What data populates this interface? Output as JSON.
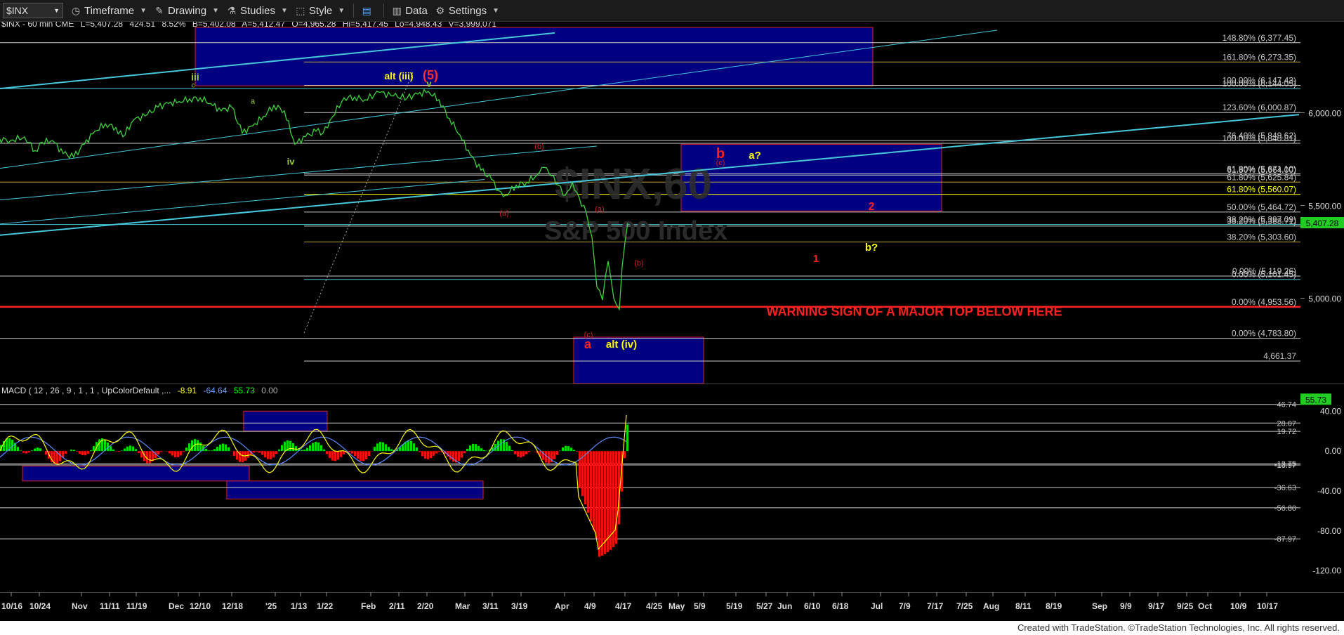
{
  "toolbar": {
    "symbol": "$INX",
    "timeframe_label": "Timeframe",
    "drawing_label": "Drawing",
    "studies_label": "Studies",
    "style_label": "Style",
    "data_label": "Data",
    "settings_label": "Settings"
  },
  "footer": {
    "credit": "Created with TradeStation. ©TradeStation Technologies, Inc. All rights reserved."
  },
  "chart_data": {
    "type": "line",
    "header": "$INX - 60 min  CME",
    "quote": {
      "last": "L=5,407.28",
      "change": "424.51",
      "pct": "8.52%",
      "bid": "B=5,402.08",
      "ask": "A=5,412.47",
      "open": "O=4,965.28",
      "high": "Hi=5,417.45",
      "low": "Lo=4,948.43",
      "volume": "V=3,999,071"
    },
    "watermark": {
      "symbol": "$INX,60",
      "name": "S&P 500 Index"
    },
    "ylim": [
      4540,
      6460
    ],
    "price_axis_ticks": [
      "6,000.00",
      "5,500.00",
      "5,000.00"
    ],
    "last_price_badge": "5,407.28",
    "x_tick_labels": [
      "10/16",
      "10/24",
      "Nov",
      "11/11",
      "11/19",
      "Dec",
      "12/10",
      "12/18",
      "'25",
      "1/13",
      "1/22",
      "Feb",
      "2/11",
      "2/20",
      "Mar",
      "3/11",
      "3/19",
      "Apr",
      "4/9",
      "4/17",
      "4/25",
      "May",
      "5/9",
      "5/19",
      "5/27",
      "Jun",
      "6/10",
      "6/18",
      "Jul",
      "7/9",
      "7/17",
      "7/25",
      "Aug",
      "8/11",
      "8/19",
      "Sep",
      "9/9",
      "9/17",
      "9/25",
      "Oct",
      "10/9",
      "10/17"
    ],
    "price_series": [
      [
        -5,
        5860
      ],
      [
        15,
        5850
      ],
      [
        35,
        5870
      ],
      [
        50,
        5795
      ],
      [
        60,
        5840
      ],
      [
        75,
        5850
      ],
      [
        90,
        5780
      ],
      [
        105,
        5760
      ],
      [
        120,
        5830
      ],
      [
        135,
        5900
      ],
      [
        150,
        5940
      ],
      [
        165,
        5920
      ],
      [
        175,
        5870
      ],
      [
        190,
        5960
      ],
      [
        210,
        5990
      ],
      [
        225,
        6030
      ],
      [
        240,
        6050
      ],
      [
        255,
        6060
      ],
      [
        270,
        6075
      ],
      [
        285,
        6080
      ],
      [
        300,
        6050
      ],
      [
        315,
        6010
      ],
      [
        330,
        6030
      ],
      [
        345,
        5890
      ],
      [
        360,
        5930
      ],
      [
        375,
        5980
      ],
      [
        390,
        6040
      ],
      [
        405,
        6010
      ],
      [
        420,
        5830
      ],
      [
        435,
        5870
      ],
      [
        450,
        5900
      ],
      [
        460,
        5890
      ],
      [
        470,
        5960
      ],
      [
        490,
        6080
      ],
      [
        505,
        6085
      ],
      [
        520,
        6070
      ],
      [
        540,
        6110
      ],
      [
        560,
        6090
      ],
      [
        580,
        6080
      ],
      [
        595,
        6100
      ],
      [
        610,
        6115
      ],
      [
        625,
        6070
      ],
      [
        640,
        5970
      ],
      [
        655,
        5880
      ],
      [
        670,
        5770
      ],
      [
        685,
        5690
      ],
      [
        700,
        5640
      ],
      [
        710,
        5580
      ],
      [
        720,
        5555
      ],
      [
        735,
        5610
      ],
      [
        750,
        5625
      ],
      [
        765,
        5665
      ],
      [
        775,
        5705
      ],
      [
        785,
        5660
      ],
      [
        795,
        5610
      ],
      [
        805,
        5555
      ],
      [
        815,
        5625
      ],
      [
        825,
        5540
      ],
      [
        835,
        5460
      ],
      [
        843,
        5330
      ],
      [
        850,
        5060
      ],
      [
        858,
        4990
      ],
      [
        866,
        5200
      ],
      [
        874,
        5000
      ],
      [
        882,
        4940
      ],
      [
        886,
        5170
      ],
      [
        890,
        5300
      ],
      [
        894,
        5407
      ]
    ],
    "fib_levels": [
      {
        "label": "148.80% (6,377.45)",
        "price": 6377.45,
        "color": "#c8c8c8"
      },
      {
        "label": "161.80% (6,273.35)",
        "price": 6273.35,
        "color": "#bfa23a"
      },
      {
        "label": "100.00% (6,147.43)",
        "price": 6147.43,
        "color": "#c8c8c8"
      },
      {
        "label": "100.00% (6,144.05)",
        "price": 6130,
        "color": "#46c8dc"
      },
      {
        "label": "123.60% (6,000.87)",
        "price": 6000.87,
        "color": "#c8c8c8"
      },
      {
        "label": "76.40% (5,849.62)",
        "price": 5849.62,
        "color": "#c8c8c8"
      },
      {
        "label": "100.00% (5,840.81)",
        "price": 5835,
        "color": "#c8c8c8"
      },
      {
        "label": "61.80% (5,671.10)",
        "price": 5671.1,
        "color": "#c8c8c8"
      },
      {
        "label": "61.80% (5,664.00)",
        "price": 5664,
        "color": "#c8c8c8"
      },
      {
        "label": "61.80% (5,625.84)",
        "price": 5625.84,
        "color": "#bfa23a"
      },
      {
        "label": "61.80% (5,560.07)",
        "price": 5560.07,
        "color": "#ffff00"
      },
      {
        "label": "50.00% (5,464.72)",
        "price": 5464.72,
        "color": "#c8c8c8"
      },
      {
        "label": "38.20% (5,397.09)",
        "price": 5397.09,
        "color": "#46c8dc"
      },
      {
        "label": "38.20% (5,388.71)",
        "price": 5388.71,
        "color": "#c8c8c8"
      },
      {
        "label": "38.20% (5,303.60)",
        "price": 5303.6,
        "color": "#bfa23a"
      },
      {
        "label": "0.00% (5,119.26)",
        "price": 5119.26,
        "color": "#c8c8c8"
      },
      {
        "label": "0.00% (5,101.45)",
        "price": 5101.45,
        "color": "#46c8dc"
      },
      {
        "label": "0.00% (4,953.56)",
        "price": 4953.56,
        "color": "#ff2020"
      },
      {
        "label": "0.00% (4,783.80)",
        "price": 4783.8,
        "color": "#c8c8c8"
      },
      {
        "label": "4,661.37",
        "price": 4661.37,
        "color": "#c8c8c8"
      }
    ],
    "boxes": [
      {
        "x0": 278,
        "x1": 1243,
        "p0": 6145,
        "p1": 6460,
        "border": "#dd2222"
      },
      {
        "x0": 970,
        "x1": 1341,
        "p0": 5470,
        "p1": 5830,
        "border": "#dd2222"
      },
      {
        "x0": 817,
        "x1": 1002,
        "p0": 4540,
        "p1": 4790,
        "border": "#dd2222"
      }
    ],
    "trendlines": [
      {
        "x0": 0,
        "p0": 6130,
        "x1": 790,
        "p1": 6430,
        "color": "#46c8dc",
        "w": 2
      },
      {
        "x0": 0,
        "p0": 5340,
        "x1": 1850,
        "p1": 5990,
        "color": "#46c8dc",
        "w": 2
      },
      {
        "x0": 0,
        "p0": 5700,
        "x1": 1420,
        "p1": 6445,
        "color": "#46c8dc",
        "w": 1
      },
      {
        "x0": 0,
        "p0": 5530,
        "x1": 850,
        "p1": 5820,
        "color": "#46c8dc",
        "w": 1
      },
      {
        "x0": 0,
        "p0": 5400,
        "x1": 690,
        "p1": 5640,
        "color": "#46c8dc",
        "w": 1
      }
    ],
    "wave_labels": [
      {
        "text": "iii",
        "x": 278,
        "p": 6175,
        "color": "#9acd32",
        "size": 14,
        "bold": true
      },
      {
        "text": "c",
        "x": 275,
        "p": 6137,
        "color": "#9acd32",
        "size": 10
      },
      {
        "text": "alt (iii)",
        "x": 568,
        "p": 6180,
        "color": "#ffff00",
        "size": 14,
        "bold": true
      },
      {
        "text": "(5)",
        "x": 613,
        "p": 6180,
        "color": "#ff3030",
        "size": 18,
        "bold": true
      },
      {
        "text": "v",
        "x": 611,
        "p": 6140,
        "color": "#9acd32",
        "size": 13,
        "bold": true
      },
      {
        "text": "a",
        "x": 360,
        "p": 6050,
        "color": "#9acd32",
        "size": 11
      },
      {
        "text": "iv",
        "x": 414,
        "p": 5720,
        "color": "#9acd32",
        "size": 13,
        "bold": true
      },
      {
        "text": "(b)",
        "x": 768,
        "p": 5805,
        "color": "#cc2020",
        "size": 11
      },
      {
        "text": "(a)",
        "x": 718,
        "p": 5446,
        "color": "#cc2020",
        "size": 11
      },
      {
        "text": "(a)",
        "x": 854,
        "p": 5468,
        "color": "#cc2020",
        "size": 11
      },
      {
        "text": "(b)",
        "x": 910,
        "p": 5177,
        "color": "#cc2020",
        "size": 11
      },
      {
        "text": "(c)",
        "x": 838,
        "p": 4790,
        "color": "#cc2020",
        "size": 11
      },
      {
        "text": "b",
        "x": 1026,
        "p": 5755,
        "color": "#ff2020",
        "size": 20,
        "bold": true
      },
      {
        "text": "(c)",
        "x": 1026,
        "p": 5718,
        "color": "#cc2020",
        "size": 11
      },
      {
        "text": "a?",
        "x": 1075,
        "p": 5752,
        "color": "#ffff00",
        "size": 15,
        "bold": true
      },
      {
        "text": "2",
        "x": 1241,
        "p": 5475,
        "color": "#ff2020",
        "size": 16,
        "bold": true
      },
      {
        "text": "b?",
        "x": 1241,
        "p": 5255,
        "color": "#ffff00",
        "size": 15,
        "bold": true
      },
      {
        "text": "1",
        "x": 1162,
        "p": 5195,
        "color": "#ff2020",
        "size": 15,
        "bold": true
      },
      {
        "text": "a",
        "x": 837,
        "p": 4730,
        "color": "#ff2020",
        "size": 18,
        "bold": true
      },
      {
        "text": "alt (iv)",
        "x": 885,
        "p": 4734,
        "color": "#ffff00",
        "size": 15,
        "bold": true
      }
    ],
    "warning": {
      "text": "WARNING SIGN OF A MAJOR TOP BELOW HERE",
      "x": 1302,
      "p": 4905,
      "color": "#ff2020"
    },
    "macd": {
      "header": "MACD ( 12 , 26 , 9 , 1 , 1 , UpColorDefault ,...",
      "values": [
        "-8.91",
        "-64.64",
        "55.73",
        "0.00"
      ],
      "value_colors": [
        "#ffff00",
        "#6aa0ff",
        "#00ff00",
        "#aaaaaa"
      ],
      "ylim": [
        -140,
        55
      ],
      "axis_ticks": [
        "40.00",
        "0.00",
        "-40.00",
        "-80.00",
        "-120.00"
      ],
      "levels": [
        {
          "label": "46.74",
          "v": 46.74
        },
        {
          "label": "28.07",
          "v": 28.07
        },
        {
          "label": "19.72",
          "v": 19.72
        },
        {
          "label": "-12.75",
          "v": -12.75
        },
        {
          "label": "-13.97",
          "v": -13.97
        },
        {
          "label": "-36.63",
          "v": -36.63
        },
        {
          "label": "-56.80",
          "v": -56.8
        },
        {
          "label": "-87.97",
          "v": -87.97
        }
      ],
      "badge": "55.73",
      "boxes": [
        {
          "x0": 347,
          "x1": 466,
          "v0": 20,
          "v1": 40
        },
        {
          "x0": 32,
          "x1": 355,
          "v0": -30,
          "v1": -15
        },
        {
          "x0": 323,
          "x1": 688,
          "v0": -48,
          "v1": -30
        }
      ]
    }
  }
}
